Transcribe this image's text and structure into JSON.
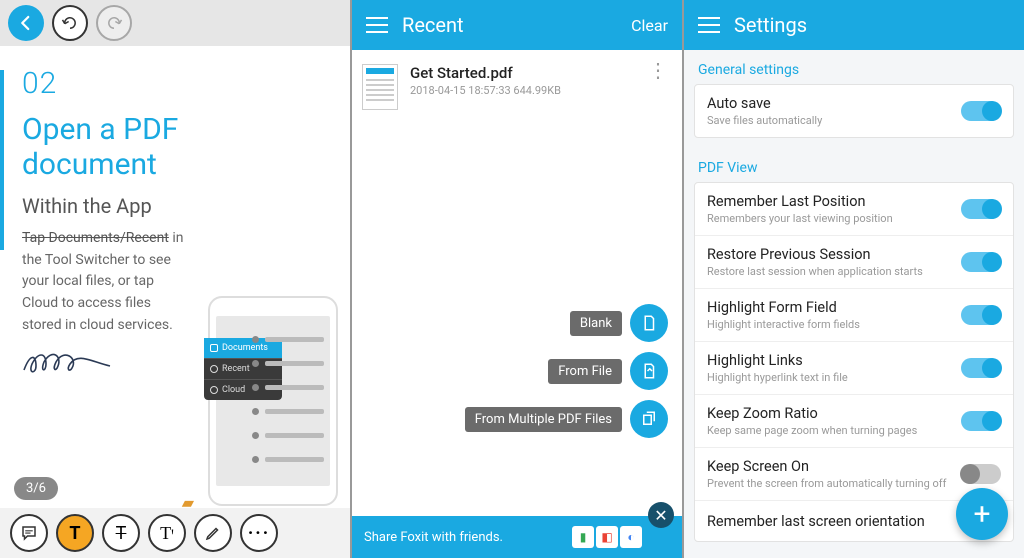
{
  "panel1": {
    "page_number": "02",
    "title_line1": "Open a PDF",
    "title_line2": "document",
    "subtitle": "Within the App",
    "strike_text": "Tap Documents/Recent",
    "body_text": "in  the Tool Switcher to see your local files, or tap Cloud to access files stored in cloud services.",
    "page_indicator": "3/6",
    "mini_menu": {
      "documents": "Documents",
      "recent": "Recent",
      "cloud": "Cloud"
    }
  },
  "panel2": {
    "header_title": "Recent",
    "clear_label": "Clear",
    "file": {
      "name": "Get Started.pdf",
      "meta": "2018-04-15 18:57:33  644.99KB"
    },
    "fab": {
      "blank": "Blank",
      "from_file": "From File",
      "from_multiple": "From Multiple PDF Files"
    },
    "share_text": "Share Foxit with friends."
  },
  "panel3": {
    "header_title": "Settings",
    "sections": {
      "general_label": "General settings",
      "pdf_view_label": "PDF View"
    },
    "settings": {
      "auto_save": {
        "title": "Auto save",
        "desc": "Save files automatically",
        "on": true
      },
      "remember_pos": {
        "title": "Remember Last Position",
        "desc": "Remembers your last viewing position",
        "on": true
      },
      "restore_session": {
        "title": "Restore Previous Session",
        "desc": "Restore last session when application starts",
        "on": true
      },
      "highlight_form": {
        "title": "Highlight Form Field",
        "desc": "Highlight interactive form fields",
        "on": true
      },
      "highlight_links": {
        "title": "Highlight Links",
        "desc": "Highlight hyperlink text in file",
        "on": true
      },
      "keep_zoom": {
        "title": "Keep Zoom Ratio",
        "desc": "Keep same page zoom when turning pages",
        "on": true
      },
      "keep_screen": {
        "title": "Keep Screen On",
        "desc": "Prevent the screen from automatically turning off",
        "on": false
      },
      "remember_orient": {
        "title": "Remember last screen orientation",
        "desc": "",
        "on": false
      }
    }
  }
}
